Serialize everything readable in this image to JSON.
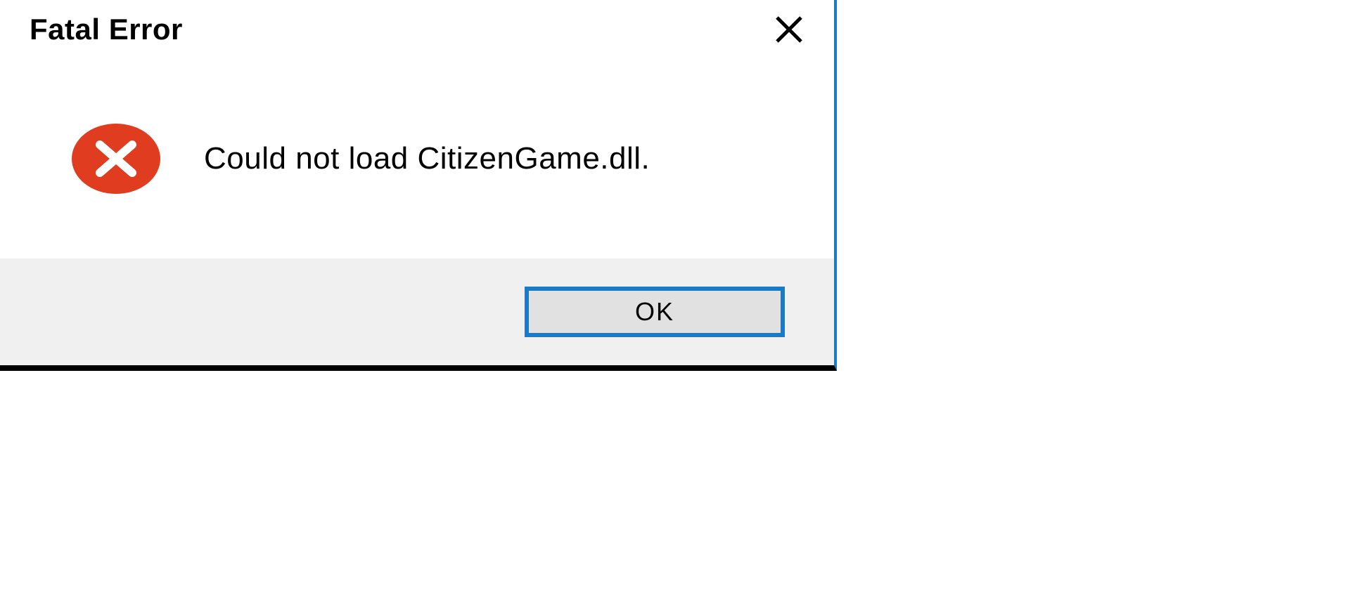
{
  "dialog": {
    "title": "Fatal Error",
    "message": "Could not load CitizenGame.dll.",
    "ok_label": "OK"
  }
}
